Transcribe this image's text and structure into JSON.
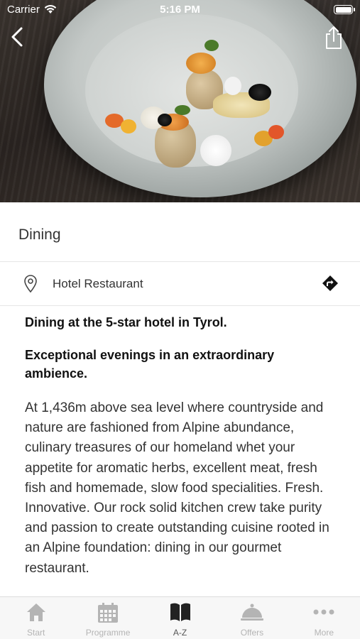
{
  "status_bar": {
    "carrier": "Carrier",
    "time": "5:16 PM"
  },
  "hero": {
    "back_icon": "chevron-left-icon",
    "share_icon": "share-icon"
  },
  "page_title": "Dining",
  "location": {
    "icon": "map-pin-icon",
    "label": "Hotel Restaurant",
    "directions_icon": "directions-icon"
  },
  "content": {
    "heading1": "Dining at the 5-star hotel in Tyrol.",
    "heading2": "Exceptional evenings in an extraordinary ambience.",
    "body": "At 1,436m above sea level where countryside and nature are fashioned from Alpine abundance, culinary treasures of our homeland whet your appetite for aromatic herbs, excellent meat, fresh fish and homemade, slow food specialities. Fresh. Innovative. Our rock solid kitchen crew take purity and passion to create outstanding cuisine rooted in an Alpine foundation: dining in our gourmet restaurant."
  },
  "tabs": [
    {
      "label": "Start",
      "icon": "home-icon",
      "active": false
    },
    {
      "label": "Programme",
      "icon": "calendar-icon",
      "active": false
    },
    {
      "label": "A-Z",
      "icon": "book-icon",
      "active": true
    },
    {
      "label": "Offers",
      "icon": "cloche-icon",
      "active": false
    },
    {
      "label": "More",
      "icon": "more-icon",
      "active": false
    }
  ],
  "colors": {
    "tab_inactive": "#b4b4b4",
    "tab_active": "#333333",
    "divider": "#e6e6e6"
  }
}
